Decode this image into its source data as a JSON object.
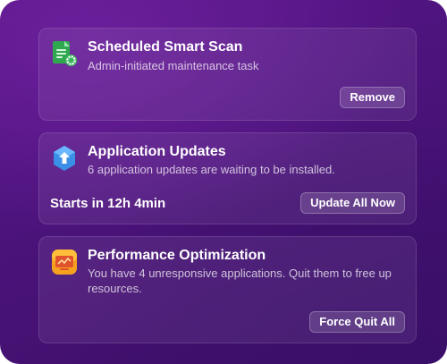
{
  "cards": [
    {
      "title": "Scheduled Smart Scan",
      "subtitle": "Admin-initiated maintenance task",
      "button": "Remove",
      "icon": "scheduled-scan-icon"
    },
    {
      "title": "Application Updates",
      "subtitle": "6 application updates are waiting to be installed.",
      "status": "Starts in 12h 4min",
      "button": "Update All Now",
      "icon": "app-update-icon"
    },
    {
      "title": "Performance Optimization",
      "subtitle": "You have 4 unresponsive applications. Quit them to free up resources.",
      "button": "Force Quit All",
      "icon": "performance-icon"
    }
  ],
  "colors": {
    "background": "#4b137b",
    "text": "#ffffff"
  }
}
